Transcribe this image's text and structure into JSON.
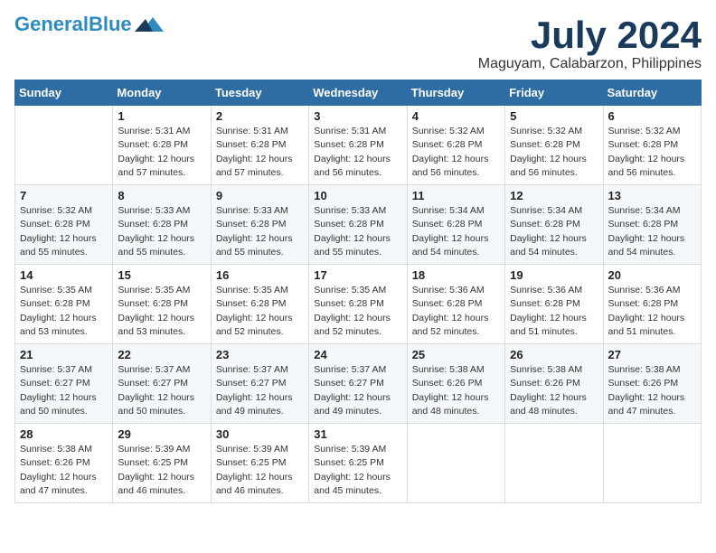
{
  "logo": {
    "general": "General",
    "blue": "Blue",
    "icon": "▶"
  },
  "header": {
    "month": "July 2024",
    "location": "Maguyam, Calabarzon, Philippines"
  },
  "weekdays": [
    "Sunday",
    "Monday",
    "Tuesday",
    "Wednesday",
    "Thursday",
    "Friday",
    "Saturday"
  ],
  "weeks": [
    [
      {
        "day": null,
        "info": null
      },
      {
        "day": "1",
        "info": "Sunrise: 5:31 AM\nSunset: 6:28 PM\nDaylight: 12 hours\nand 57 minutes."
      },
      {
        "day": "2",
        "info": "Sunrise: 5:31 AM\nSunset: 6:28 PM\nDaylight: 12 hours\nand 57 minutes."
      },
      {
        "day": "3",
        "info": "Sunrise: 5:31 AM\nSunset: 6:28 PM\nDaylight: 12 hours\nand 56 minutes."
      },
      {
        "day": "4",
        "info": "Sunrise: 5:32 AM\nSunset: 6:28 PM\nDaylight: 12 hours\nand 56 minutes."
      },
      {
        "day": "5",
        "info": "Sunrise: 5:32 AM\nSunset: 6:28 PM\nDaylight: 12 hours\nand 56 minutes."
      },
      {
        "day": "6",
        "info": "Sunrise: 5:32 AM\nSunset: 6:28 PM\nDaylight: 12 hours\nand 56 minutes."
      }
    ],
    [
      {
        "day": "7",
        "info": "Sunrise: 5:32 AM\nSunset: 6:28 PM\nDaylight: 12 hours\nand 55 minutes."
      },
      {
        "day": "8",
        "info": "Sunrise: 5:33 AM\nSunset: 6:28 PM\nDaylight: 12 hours\nand 55 minutes."
      },
      {
        "day": "9",
        "info": "Sunrise: 5:33 AM\nSunset: 6:28 PM\nDaylight: 12 hours\nand 55 minutes."
      },
      {
        "day": "10",
        "info": "Sunrise: 5:33 AM\nSunset: 6:28 PM\nDaylight: 12 hours\nand 55 minutes."
      },
      {
        "day": "11",
        "info": "Sunrise: 5:34 AM\nSunset: 6:28 PM\nDaylight: 12 hours\nand 54 minutes."
      },
      {
        "day": "12",
        "info": "Sunrise: 5:34 AM\nSunset: 6:28 PM\nDaylight: 12 hours\nand 54 minutes."
      },
      {
        "day": "13",
        "info": "Sunrise: 5:34 AM\nSunset: 6:28 PM\nDaylight: 12 hours\nand 54 minutes."
      }
    ],
    [
      {
        "day": "14",
        "info": "Sunrise: 5:35 AM\nSunset: 6:28 PM\nDaylight: 12 hours\nand 53 minutes."
      },
      {
        "day": "15",
        "info": "Sunrise: 5:35 AM\nSunset: 6:28 PM\nDaylight: 12 hours\nand 53 minutes."
      },
      {
        "day": "16",
        "info": "Sunrise: 5:35 AM\nSunset: 6:28 PM\nDaylight: 12 hours\nand 52 minutes."
      },
      {
        "day": "17",
        "info": "Sunrise: 5:35 AM\nSunset: 6:28 PM\nDaylight: 12 hours\nand 52 minutes."
      },
      {
        "day": "18",
        "info": "Sunrise: 5:36 AM\nSunset: 6:28 PM\nDaylight: 12 hours\nand 52 minutes."
      },
      {
        "day": "19",
        "info": "Sunrise: 5:36 AM\nSunset: 6:28 PM\nDaylight: 12 hours\nand 51 minutes."
      },
      {
        "day": "20",
        "info": "Sunrise: 5:36 AM\nSunset: 6:28 PM\nDaylight: 12 hours\nand 51 minutes."
      }
    ],
    [
      {
        "day": "21",
        "info": "Sunrise: 5:37 AM\nSunset: 6:27 PM\nDaylight: 12 hours\nand 50 minutes."
      },
      {
        "day": "22",
        "info": "Sunrise: 5:37 AM\nSunset: 6:27 PM\nDaylight: 12 hours\nand 50 minutes."
      },
      {
        "day": "23",
        "info": "Sunrise: 5:37 AM\nSunset: 6:27 PM\nDaylight: 12 hours\nand 49 minutes."
      },
      {
        "day": "24",
        "info": "Sunrise: 5:37 AM\nSunset: 6:27 PM\nDaylight: 12 hours\nand 49 minutes."
      },
      {
        "day": "25",
        "info": "Sunrise: 5:38 AM\nSunset: 6:26 PM\nDaylight: 12 hours\nand 48 minutes."
      },
      {
        "day": "26",
        "info": "Sunrise: 5:38 AM\nSunset: 6:26 PM\nDaylight: 12 hours\nand 48 minutes."
      },
      {
        "day": "27",
        "info": "Sunrise: 5:38 AM\nSunset: 6:26 PM\nDaylight: 12 hours\nand 47 minutes."
      }
    ],
    [
      {
        "day": "28",
        "info": "Sunrise: 5:38 AM\nSunset: 6:26 PM\nDaylight: 12 hours\nand 47 minutes."
      },
      {
        "day": "29",
        "info": "Sunrise: 5:39 AM\nSunset: 6:25 PM\nDaylight: 12 hours\nand 46 minutes."
      },
      {
        "day": "30",
        "info": "Sunrise: 5:39 AM\nSunset: 6:25 PM\nDaylight: 12 hours\nand 46 minutes."
      },
      {
        "day": "31",
        "info": "Sunrise: 5:39 AM\nSunset: 6:25 PM\nDaylight: 12 hours\nand 45 minutes."
      },
      {
        "day": null,
        "info": null
      },
      {
        "day": null,
        "info": null
      },
      {
        "day": null,
        "info": null
      }
    ]
  ]
}
